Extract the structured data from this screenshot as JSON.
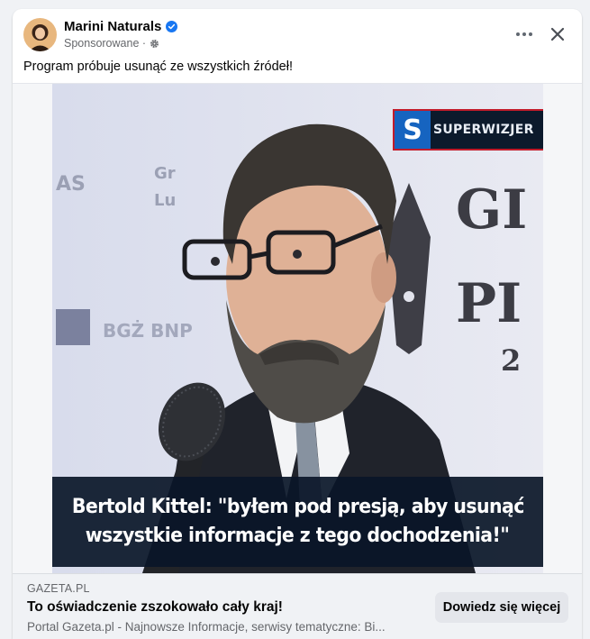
{
  "post": {
    "page_name": "Marini Naturals",
    "sponsored_label": "Sponsorowane ·",
    "caption": "Program próbuje usunąć ze wszystkich źródeł!"
  },
  "media": {
    "channel_name": "SUPERWIZJER",
    "channel_letter": "S",
    "banner_line_1": "Bertold Kittel: \"byłem pod presją, aby usunąć",
    "banner_line_2": "wszystkie informacje z tego dochodzenia!\"",
    "backdrop_text": [
      "AS",
      "GI",
      "PI",
      "2",
      "BGŻ BNP",
      "Gr",
      "Lu"
    ]
  },
  "link_preview": {
    "domain": "GAZETA.PL",
    "headline": "To oświadczenie zszokowało cały kraj!",
    "description": "Portal Gazeta.pl - Najnowsze Informacje, serwisy tematyczne: Bi...",
    "cta_label": "Dowiedz się więcej"
  },
  "icons": {
    "verified": "verified-badge-icon",
    "audience": "gear-icon",
    "more": "more-options-icon",
    "close": "close-icon"
  },
  "colors": {
    "verified_blue": "#1877f2",
    "banner_bg": "#0a1628",
    "channel_red": "#c21b2a",
    "channel_blue": "#1664c0"
  }
}
